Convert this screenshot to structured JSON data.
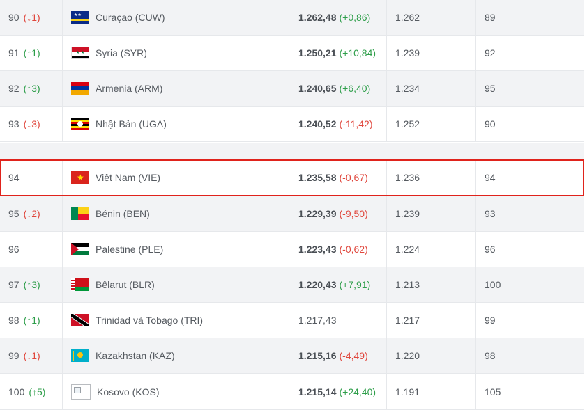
{
  "rows": [
    {
      "rank": "90",
      "move": "(↓1)",
      "dir": "down",
      "team": "Curaçao (CUW)",
      "flag": "cuw",
      "points": "1.262,48",
      "change": "(+0,86)",
      "chg_dir": "up",
      "prev_points": "1.262",
      "prev_rank": "89"
    },
    {
      "rank": "91",
      "move": "(↑1)",
      "dir": "up",
      "team": "Syria (SYR)",
      "flag": "syr",
      "points": "1.250,21",
      "change": "(+10,84)",
      "chg_dir": "up",
      "prev_points": "1.239",
      "prev_rank": "92"
    },
    {
      "rank": "92",
      "move": "(↑3)",
      "dir": "up",
      "team": "Armenia (ARM)",
      "flag": "arm",
      "points": "1.240,65",
      "change": "(+6,40)",
      "chg_dir": "up",
      "prev_points": "1.234",
      "prev_rank": "95"
    },
    {
      "rank": "93",
      "move": "(↓3)",
      "dir": "down",
      "team": "Nhật Bản (UGA)",
      "flag": "uga",
      "points": "1.240,52",
      "change": "(-11,42)",
      "chg_dir": "down",
      "prev_points": "1.252",
      "prev_rank": "90"
    },
    {
      "rank": "94",
      "move": "",
      "dir": "",
      "team": "Việt Nam (VIE)",
      "flag": "vie",
      "points": "1.235,58",
      "change": "(-0,67)",
      "chg_dir": "down",
      "prev_points": "1.236",
      "prev_rank": "94"
    },
    {
      "rank": "95",
      "move": "(↓2)",
      "dir": "down",
      "team": "Bénin (BEN)",
      "flag": "ben",
      "points": "1.229,39",
      "change": "(-9,50)",
      "chg_dir": "down",
      "prev_points": "1.239",
      "prev_rank": "93"
    },
    {
      "rank": "96",
      "move": "",
      "dir": "",
      "team": "Palestine (PLE)",
      "flag": "ple",
      "points": "1.223,43",
      "change": "(-0,62)",
      "chg_dir": "down",
      "prev_points": "1.224",
      "prev_rank": "96"
    },
    {
      "rank": "97",
      "move": "(↑3)",
      "dir": "up",
      "team": "Bêlarut (BLR)",
      "flag": "blr",
      "points": "1.220,43",
      "change": "(+7,91)",
      "chg_dir": "up",
      "prev_points": "1.213",
      "prev_rank": "100"
    },
    {
      "rank": "98",
      "move": "(↑1)",
      "dir": "up",
      "team": "Trinidad và Tobago (TRI)",
      "flag": "tri",
      "points": "1.217,43",
      "change": "",
      "chg_dir": "",
      "prev_points": "1.217",
      "prev_rank": "99"
    },
    {
      "rank": "99",
      "move": "(↓1)",
      "dir": "down",
      "team": "Kazakhstan (KAZ)",
      "flag": "kaz",
      "points": "1.215,16",
      "change": "(-4,49)",
      "chg_dir": "down",
      "prev_points": "1.220",
      "prev_rank": "98"
    },
    {
      "rank": "100",
      "move": "(↑5)",
      "dir": "up",
      "team": "Kosovo (KOS)",
      "flag": "kos",
      "points": "1.215,14",
      "change": "(+24,40)",
      "chg_dir": "up",
      "prev_points": "1.191",
      "prev_rank": "105"
    }
  ],
  "colors": {
    "up": "#2e9e4a",
    "down": "#e0463c",
    "highlight_border": "#e0231c",
    "stripe": "#f2f3f5"
  }
}
